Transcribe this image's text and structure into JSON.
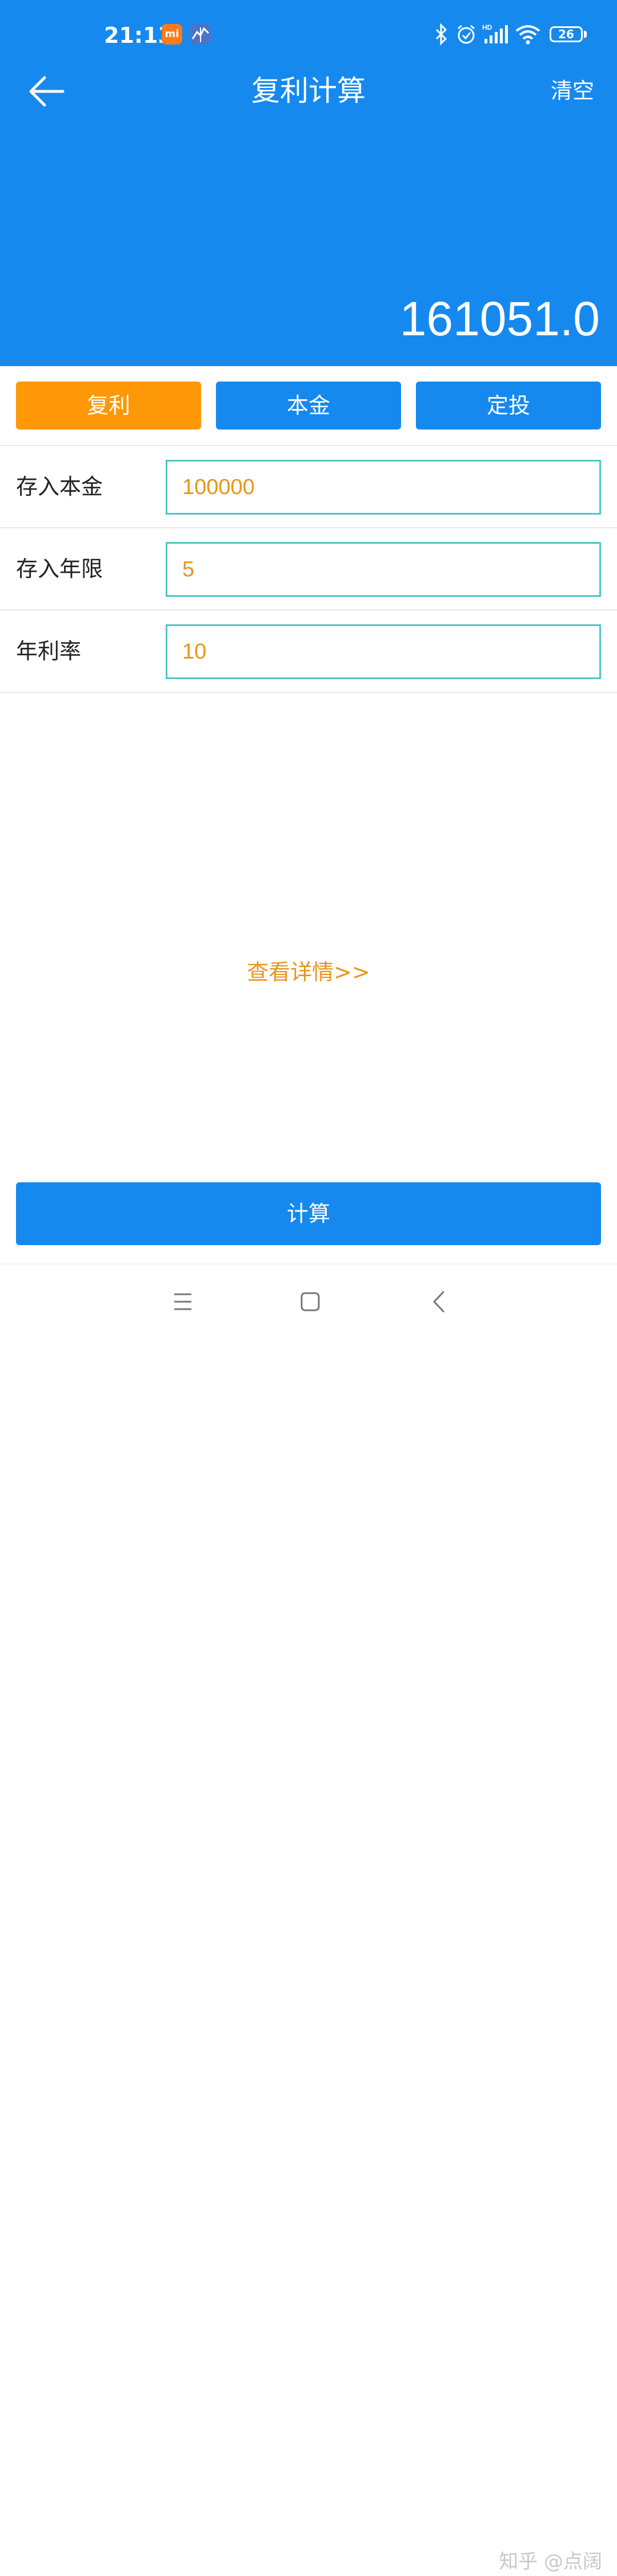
{
  "status_bar": {
    "time": "21:13",
    "mi_badge": "mi",
    "battery_level": "26",
    "icons": [
      "mi-app-icon",
      "chart-app-icon",
      "bluetooth-icon",
      "alarm-icon",
      "hd-signal-icon",
      "wifi-icon",
      "battery-icon"
    ]
  },
  "header": {
    "title": "复利计算",
    "clear_label": "清空",
    "result": "161051.0",
    "back_icon": "arrow-left-icon"
  },
  "tabs": [
    {
      "label": "复利",
      "active": true
    },
    {
      "label": "本金",
      "active": false
    },
    {
      "label": "定投",
      "active": false
    }
  ],
  "form": {
    "principal": {
      "label": "存入本金",
      "value": "100000"
    },
    "years": {
      "label": "存入年限",
      "value": "5"
    },
    "rate": {
      "label": "年利率",
      "value": "10"
    }
  },
  "details_label": "查看详情>>",
  "calculate_label": "计算",
  "nav": {
    "icons": [
      "menu-icon",
      "home-icon",
      "back-icon"
    ]
  },
  "watermark": "知乎 @点阔",
  "colors": {
    "primary": "#1689ef",
    "accent": "#ff9807",
    "input_border": "#4fc6c4",
    "value_text": "#e8961a"
  }
}
